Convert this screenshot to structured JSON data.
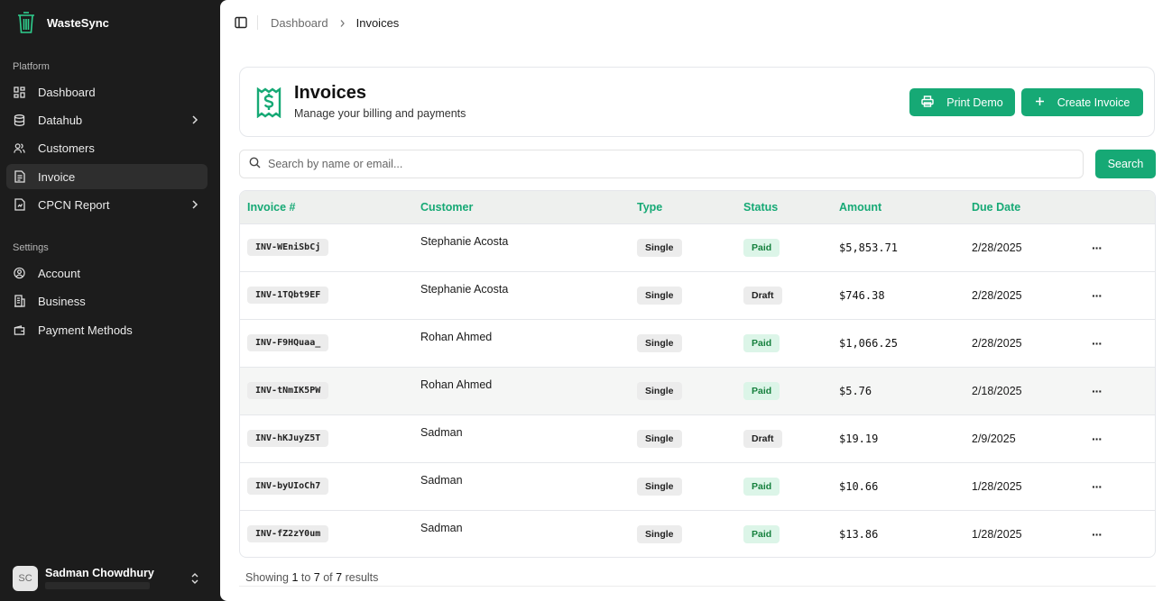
{
  "app": {
    "name": "WasteSync"
  },
  "sidebar": {
    "platform_label": "Platform",
    "settings_label": "Settings",
    "platform_items": [
      {
        "label": "Dashboard",
        "icon": "grid-icon"
      },
      {
        "label": "Datahub",
        "icon": "database-icon",
        "has_submenu": true
      },
      {
        "label": "Customers",
        "icon": "users-icon"
      },
      {
        "label": "Invoice",
        "icon": "file-icon",
        "active": true
      },
      {
        "label": "CPCN Report",
        "icon": "report-icon",
        "has_submenu": true
      }
    ],
    "settings_items": [
      {
        "label": "Account",
        "icon": "user-circle-icon"
      },
      {
        "label": "Business",
        "icon": "building-icon"
      },
      {
        "label": "Payment Methods",
        "icon": "wallet-icon"
      }
    ],
    "user": {
      "initials": "SC",
      "name": "Sadman Chowdhury"
    }
  },
  "breadcrumb": {
    "parent": "Dashboard",
    "current": "Invoices"
  },
  "header": {
    "title": "Invoices",
    "subtitle": "Manage your billing and payments",
    "print_label": "Print Demo",
    "create_label": "Create Invoice"
  },
  "search": {
    "placeholder": "Search by name or email...",
    "value": "",
    "button_label": "Search"
  },
  "table": {
    "columns": [
      "Invoice #",
      "Customer",
      "Type",
      "Status",
      "Amount",
      "Due Date"
    ],
    "rows": [
      {
        "invoice": "INV-WEniSbCj",
        "customer": "Stephanie Acosta",
        "type": "Single",
        "status": "Paid",
        "amount": "$5,853.71",
        "due": "2/28/2025"
      },
      {
        "invoice": "INV-1TQbt9EF",
        "customer": "Stephanie Acosta",
        "type": "Single",
        "status": "Draft",
        "amount": "$746.38",
        "due": "2/28/2025"
      },
      {
        "invoice": "INV-F9HQuaa_",
        "customer": "Rohan Ahmed",
        "type": "Single",
        "status": "Paid",
        "amount": "$1,066.25",
        "due": "2/28/2025"
      },
      {
        "invoice": "INV-tNmIK5PW",
        "customer": "Rohan Ahmed",
        "type": "Single",
        "status": "Paid",
        "amount": "$5.76",
        "due": "2/18/2025"
      },
      {
        "invoice": "INV-hKJuyZ5T",
        "customer": "Sadman",
        "type": "Single",
        "status": "Draft",
        "amount": "$19.19",
        "due": "2/9/2025"
      },
      {
        "invoice": "INV-byUIoCh7",
        "customer": "Sadman",
        "type": "Single",
        "status": "Paid",
        "amount": "$10.66",
        "due": "1/28/2025"
      },
      {
        "invoice": "INV-fZ2zY0um",
        "customer": "Sadman",
        "type": "Single",
        "status": "Paid",
        "amount": "$13.86",
        "due": "1/28/2025"
      }
    ],
    "more_label": "···"
  },
  "pagination": {
    "prefix": "Showing",
    "from": "1",
    "to_word": "to",
    "to": "7",
    "of_word": "of",
    "total": "7",
    "suffix": "results"
  },
  "colors": {
    "accent": "#16a975",
    "sidebar_bg": "#1c1c1c",
    "paid_bg": "#dcf5e8"
  }
}
